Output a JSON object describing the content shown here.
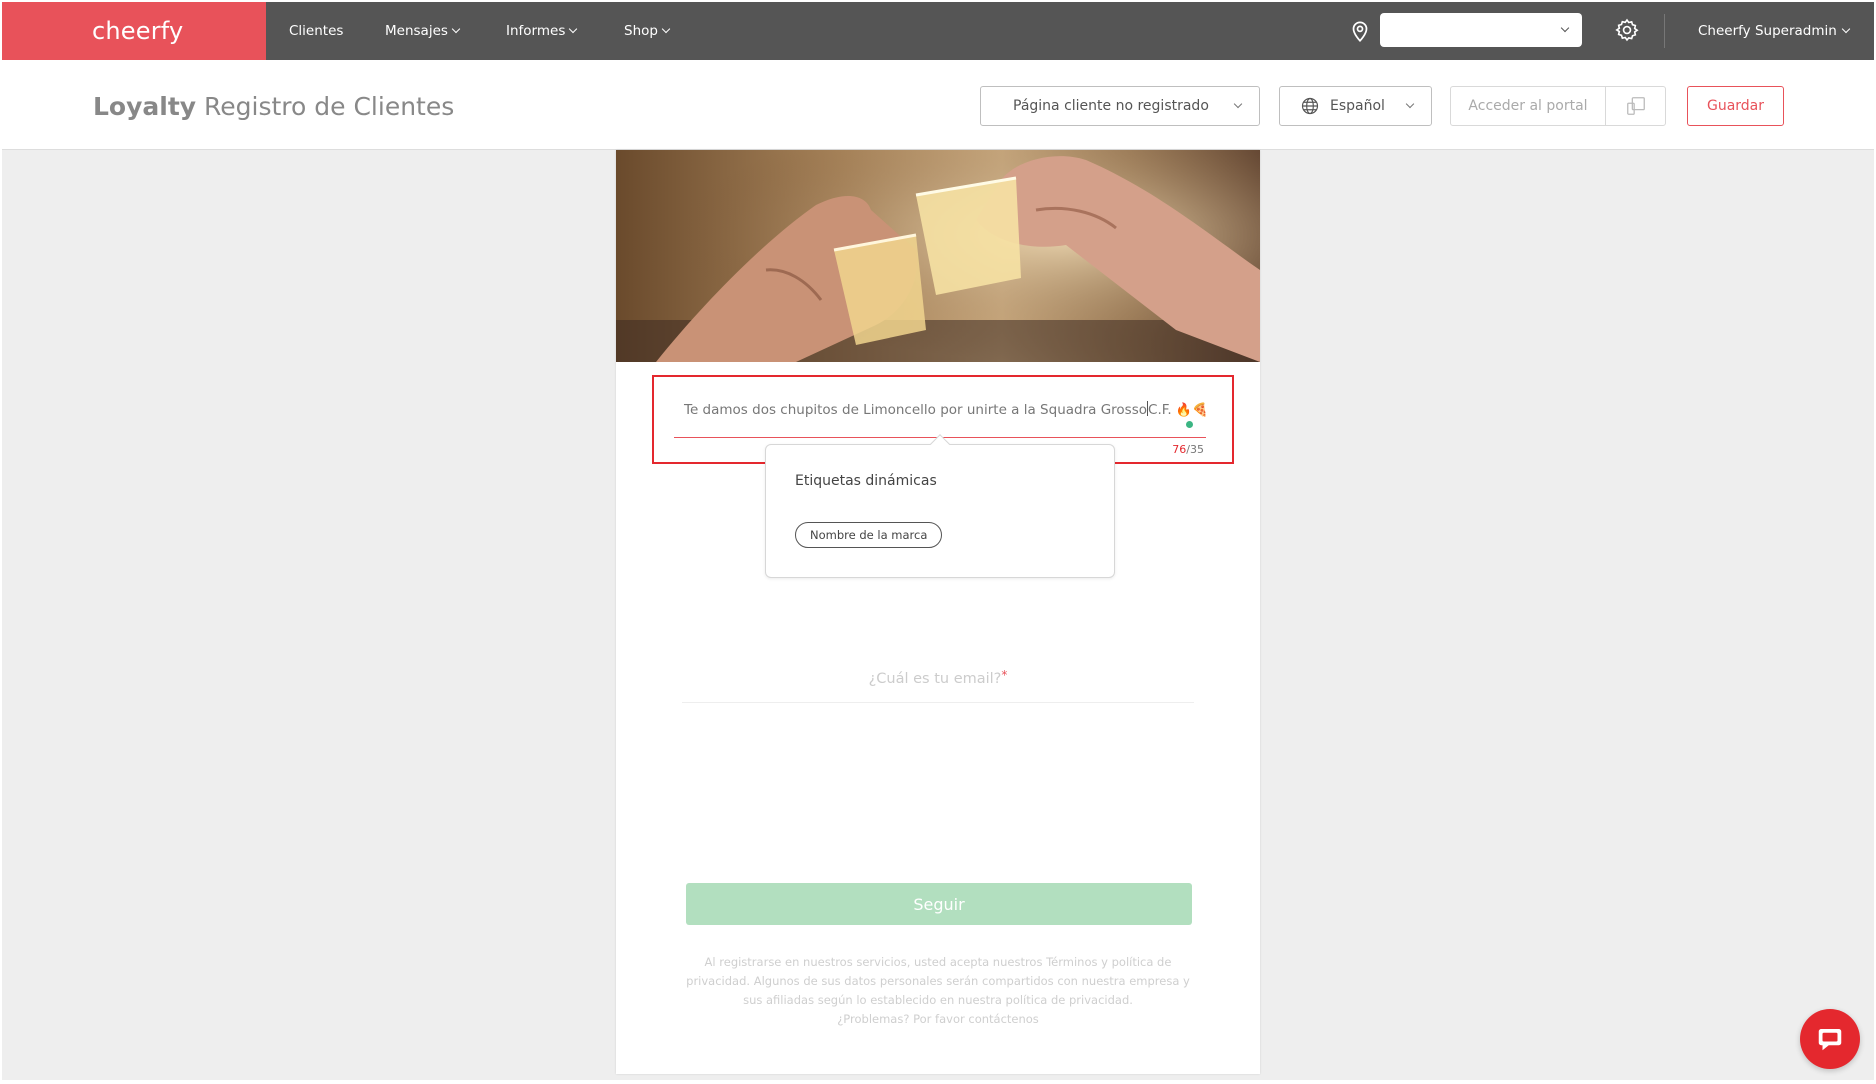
{
  "brand": {
    "logo": "cheerfy",
    "accent": "#e8525a",
    "topbar": "#555555"
  },
  "nav": {
    "items": [
      {
        "label": "Clientes",
        "has_menu": false
      },
      {
        "label": "Mensajes",
        "has_menu": true
      },
      {
        "label": "Informes",
        "has_menu": true
      },
      {
        "label": "Shop",
        "has_menu": true
      }
    ],
    "location_icon": "map-pin-icon",
    "location_value": "",
    "settings_icon": "gear-icon",
    "user": "Cheerfy Superadmin"
  },
  "header": {
    "title_bold": "Loyalty",
    "title_rest": " Registro de Clientes",
    "page_select": "Página cliente no registrado",
    "language_select": "Español",
    "portal_label": "Acceder al portal",
    "device_icon": "devices-icon",
    "save_label": "Guardar"
  },
  "preview": {
    "hero_image": "toasting-shot-glasses",
    "headline_before_caret": "Te damos dos chupitos de Limoncello por unirte a la Squadra Grosso",
    "headline_after_caret": "C.F. ",
    "headline_emojis": "🔥🍕",
    "counter_current": "76",
    "counter_max": "/35",
    "dynamic_tags_title": "Etiquetas dinámicas",
    "dynamic_tags": [
      "Nombre de la marca"
    ],
    "email_label": "¿Cuál es tu email?",
    "email_required": "*",
    "continue_label": "Seguir",
    "legal_lines": [
      "Al registrarse en nuestros servicios, usted acepta nuestros Términos y política de",
      "privacidad. Algunos de sus datos personales serán compartidos con nuestra empresa y",
      "sus afiliadas según lo establecido en nuestra política de privacidad.",
      "¿Problemas? Por favor contáctenos"
    ]
  },
  "chat_icon": "chat-bubble-icon"
}
